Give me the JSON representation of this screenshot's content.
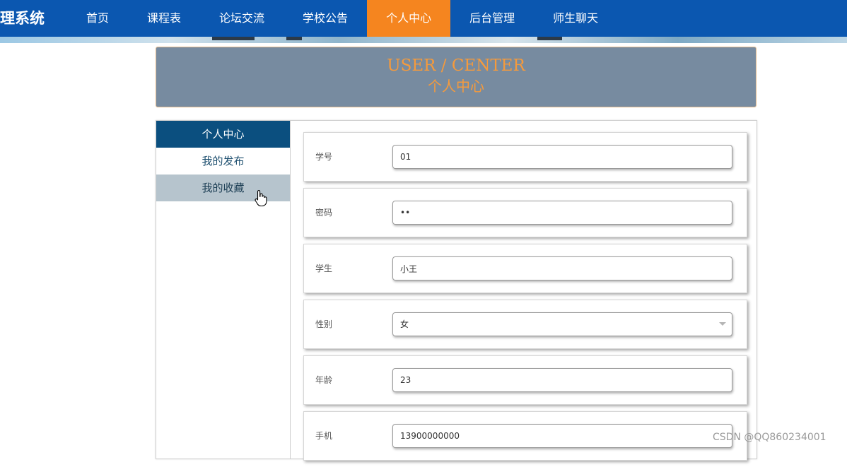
{
  "nav": {
    "brand": "理系统",
    "items": [
      {
        "label": "首页",
        "active": false
      },
      {
        "label": "课程表",
        "active": false
      },
      {
        "label": "论坛交流",
        "active": false
      },
      {
        "label": "学校公告",
        "active": false
      },
      {
        "label": "个人中心",
        "active": true
      },
      {
        "label": "后台管理",
        "active": false
      },
      {
        "label": "师生聊天",
        "active": false
      }
    ]
  },
  "banner": {
    "title_en": "USER / CENTER",
    "title_cn": "个人中心"
  },
  "sidebar": {
    "items": [
      {
        "label": "个人中心",
        "state": "active"
      },
      {
        "label": "我的发布",
        "state": "normal"
      },
      {
        "label": "我的收藏",
        "state": "hover"
      }
    ]
  },
  "form": {
    "fields": [
      {
        "label": "学号",
        "value": "01"
      },
      {
        "label": "密码",
        "value": "••"
      },
      {
        "label": "学生",
        "value": "小王"
      },
      {
        "label": "性别",
        "value": "女"
      },
      {
        "label": "年龄",
        "value": "23"
      },
      {
        "label": "手机",
        "value": "13900000000"
      }
    ]
  },
  "watermark": "CSDN @QQ860234001",
  "colors": {
    "nav_bg": "#0b57b0",
    "nav_active": "#f5851f",
    "banner_bg": "#778ba0",
    "banner_text": "#f59a3c",
    "sidebar_active": "#0b4f7f",
    "sidebar_hover": "#b6c4cd"
  }
}
